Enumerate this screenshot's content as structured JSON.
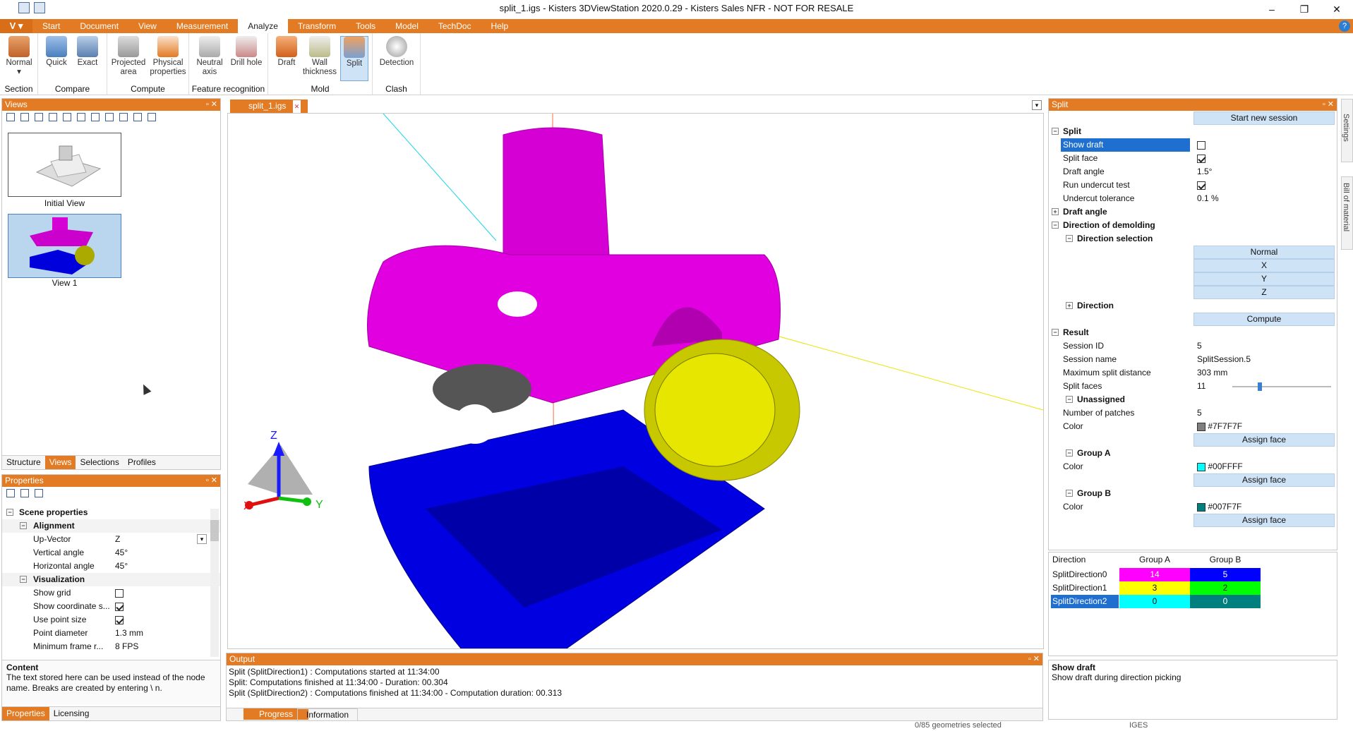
{
  "window": {
    "title": "split_1.igs - Kisters 3DViewStation 2020.0.29 - Kisters Sales NFR - NOT FOR RESALE"
  },
  "menu": {
    "logo": "V",
    "items": [
      "Start",
      "Document",
      "View",
      "Measurement",
      "Analyze",
      "Transform",
      "Tools",
      "Model",
      "TechDoc",
      "Help"
    ],
    "active": "Analyze"
  },
  "ribbon": {
    "section": {
      "label": "Section",
      "normal": "Normal"
    },
    "compare": {
      "label": "Compare",
      "quick": "Quick",
      "exact": "Exact"
    },
    "compute": {
      "label": "Compute",
      "projected": "Projected area",
      "physical": "Physical properties"
    },
    "feature": {
      "label": "Feature recognition",
      "neutral": "Neutral axis",
      "drill": "Drill hole"
    },
    "mold": {
      "label": "Mold",
      "draft": "Draft",
      "wall": "Wall thickness",
      "split": "Split"
    },
    "clash": {
      "label": "Clash",
      "detection": "Detection"
    }
  },
  "views_panel": {
    "title": "Views",
    "thumbs": [
      "Initial View",
      "View 1"
    ],
    "tabs": [
      "Structure",
      "Views",
      "Selections",
      "Profiles"
    ]
  },
  "properties_panel": {
    "title": "Properties",
    "scene": "Scene properties",
    "alignment": "Alignment",
    "up_vector": {
      "k": "Up-Vector",
      "v": "Z"
    },
    "vertical": {
      "k": "Vertical angle",
      "v": "45°"
    },
    "horizontal": {
      "k": "Horizontal angle",
      "v": "45°"
    },
    "visualization": "Visualization",
    "show_grid": "Show grid",
    "show_coord": "Show coordinate s...",
    "use_point": "Use point size",
    "point_diam": {
      "k": "Point diameter",
      "v": "1.3 mm"
    },
    "min_frame": {
      "k": "Minimum frame r...",
      "v": "8 FPS"
    },
    "content_title": "Content",
    "content_text": "The text stored here can be used instead of the node name. Breaks are created by entering \\ n.",
    "tabs": [
      "Properties",
      "Licensing"
    ]
  },
  "document": {
    "tab": "split_1.igs"
  },
  "axes": {
    "x": "X",
    "y": "Y",
    "z": "Z"
  },
  "output": {
    "title": "Output",
    "lines": [
      "Split (SplitDirection1) : Computations started at 11:34:00",
      "Split: Computations finished at 11:34:00 - Duration: 00.304",
      "Split (SplitDirection2) : Computations finished at 11:34:00 - Computation duration: 00.313"
    ],
    "tabs": [
      "Progress",
      "Information"
    ]
  },
  "split_panel": {
    "title": "Split",
    "start_new": "Start new session",
    "split": "Split",
    "show_draft": "Show draft",
    "split_face": "Split face",
    "draft_angle_k": "Draft angle",
    "draft_angle_v": "1.5°",
    "run_undercut": "Run undercut test",
    "undercut_tol_k": "Undercut tolerance",
    "undercut_tol_v": "0.1 %",
    "draft_angle_grp": "Draft angle",
    "direction_demolding": "Direction of demolding",
    "direction_selection": "Direction selection",
    "dir_buttons": [
      "Normal",
      "X",
      "Y",
      "Z"
    ],
    "direction": "Direction",
    "compute": "Compute",
    "result": "Result",
    "session_id_k": "Session ID",
    "session_id_v": "5",
    "session_name_k": "Session name",
    "session_name_v": "SplitSession.5",
    "max_split_k": "Maximum split distance",
    "max_split_v": "303 mm",
    "split_faces_k": "Split faces",
    "split_faces_v": "11",
    "split_faces_slider": 0.27,
    "unassigned": "Unassigned",
    "num_patches_k": "Number of patches",
    "num_patches_v": "5",
    "color_k": "Color",
    "unassigned_color": "#7F7F7F",
    "assign_face": "Assign face",
    "group_a": "Group A",
    "group_a_color": "#00FFFF",
    "group_b": "Group B",
    "group_b_color": "#007F7F"
  },
  "direction_table": {
    "headers": [
      "Direction",
      "Group A",
      "Group B"
    ],
    "rows": [
      {
        "name": "SplitDirection0",
        "a": "14",
        "b": "5",
        "a_color": "#ff00ff",
        "b_color": "#0000ff"
      },
      {
        "name": "SplitDirection1",
        "a": "3",
        "b": "2",
        "a_color": "#ffff00",
        "b_color": "#00ff00"
      },
      {
        "name": "SplitDirection2",
        "a": "0",
        "b": "0",
        "a_color": "#00ffff",
        "b_color": "#007f7f"
      }
    ]
  },
  "help_box": {
    "title": "Show draft",
    "text": "Show draft during direction picking"
  },
  "side_tabs": [
    "Settings",
    "Bill of material"
  ],
  "statusbar": {
    "selected": "0/85 geometries selected",
    "format": "IGES"
  }
}
